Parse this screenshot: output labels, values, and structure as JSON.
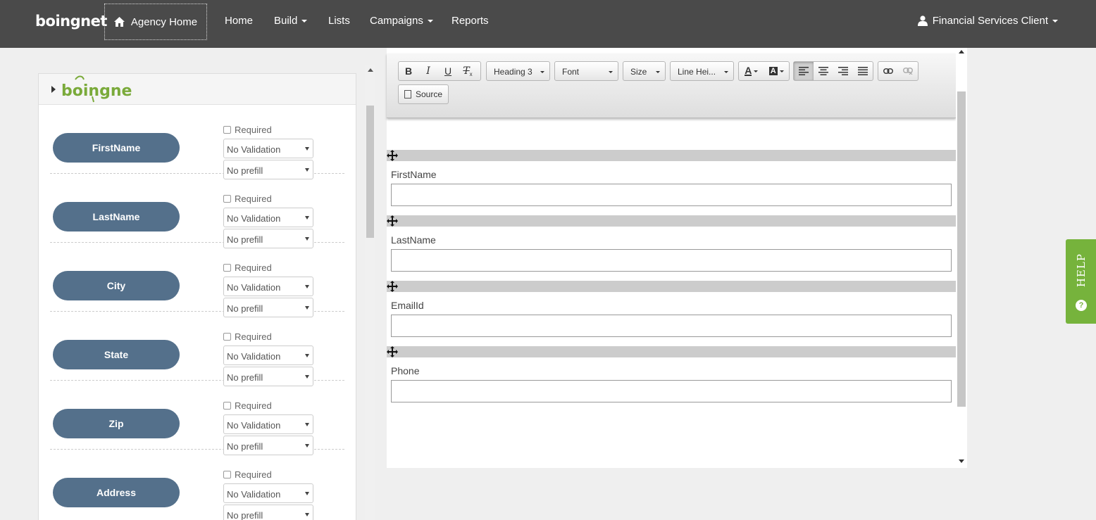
{
  "nav": {
    "logo_text": "boingnet",
    "agency_home": "Agency Home",
    "items": [
      "Home",
      "Build",
      "Lists",
      "Campaigns",
      "Reports"
    ],
    "user": "Financial Services Client"
  },
  "left": {
    "logo_text": "boingnet",
    "required_label": "Required",
    "fields": [
      {
        "name": "FirstName",
        "validation": "No Validation",
        "prefill": "No prefill"
      },
      {
        "name": "LastName",
        "validation": "No Validation",
        "prefill": "No prefill"
      },
      {
        "name": "City",
        "validation": "No Validation",
        "prefill": "No prefill"
      },
      {
        "name": "State",
        "validation": "No Validation",
        "prefill": "No prefill"
      },
      {
        "name": "Zip",
        "validation": "No Validation",
        "prefill": "No prefill"
      },
      {
        "name": "Address",
        "validation": "No Validation",
        "prefill": "No prefill"
      }
    ]
  },
  "toolbar": {
    "bold": "B",
    "italic": "I",
    "underline": "U",
    "clear": "T",
    "format": "Heading 3",
    "font": "Font",
    "size": "Size",
    "line_height": "Line Hei...",
    "text_color": "A",
    "bg_color": "A",
    "source": "Source"
  },
  "form": {
    "fields": [
      "FirstName",
      "LastName",
      "EmailId",
      "Phone"
    ]
  },
  "help": {
    "label": "HELP",
    "q": "?"
  },
  "colors": {
    "navbar": "#4a4a4a",
    "pill": "#54708b",
    "help": "#76b33c"
  }
}
